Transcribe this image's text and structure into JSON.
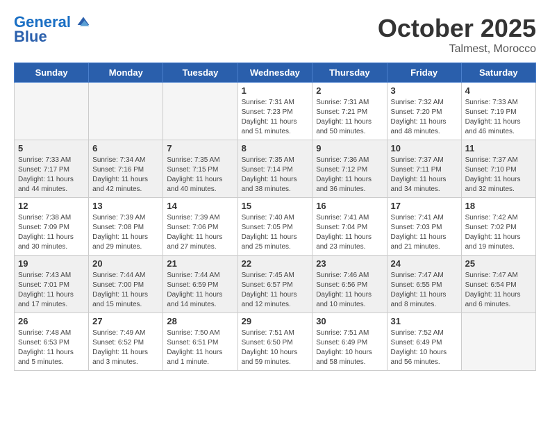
{
  "header": {
    "logo_line1": "General",
    "logo_line2": "Blue",
    "month": "October 2025",
    "location": "Talmest, Morocco"
  },
  "weekdays": [
    "Sunday",
    "Monday",
    "Tuesday",
    "Wednesday",
    "Thursday",
    "Friday",
    "Saturday"
  ],
  "weeks": [
    [
      {
        "day": "",
        "info": ""
      },
      {
        "day": "",
        "info": ""
      },
      {
        "day": "",
        "info": ""
      },
      {
        "day": "1",
        "info": "Sunrise: 7:31 AM\nSunset: 7:23 PM\nDaylight: 11 hours\nand 51 minutes."
      },
      {
        "day": "2",
        "info": "Sunrise: 7:31 AM\nSunset: 7:21 PM\nDaylight: 11 hours\nand 50 minutes."
      },
      {
        "day": "3",
        "info": "Sunrise: 7:32 AM\nSunset: 7:20 PM\nDaylight: 11 hours\nand 48 minutes."
      },
      {
        "day": "4",
        "info": "Sunrise: 7:33 AM\nSunset: 7:19 PM\nDaylight: 11 hours\nand 46 minutes."
      }
    ],
    [
      {
        "day": "5",
        "info": "Sunrise: 7:33 AM\nSunset: 7:17 PM\nDaylight: 11 hours\nand 44 minutes."
      },
      {
        "day": "6",
        "info": "Sunrise: 7:34 AM\nSunset: 7:16 PM\nDaylight: 11 hours\nand 42 minutes."
      },
      {
        "day": "7",
        "info": "Sunrise: 7:35 AM\nSunset: 7:15 PM\nDaylight: 11 hours\nand 40 minutes."
      },
      {
        "day": "8",
        "info": "Sunrise: 7:35 AM\nSunset: 7:14 PM\nDaylight: 11 hours\nand 38 minutes."
      },
      {
        "day": "9",
        "info": "Sunrise: 7:36 AM\nSunset: 7:12 PM\nDaylight: 11 hours\nand 36 minutes."
      },
      {
        "day": "10",
        "info": "Sunrise: 7:37 AM\nSunset: 7:11 PM\nDaylight: 11 hours\nand 34 minutes."
      },
      {
        "day": "11",
        "info": "Sunrise: 7:37 AM\nSunset: 7:10 PM\nDaylight: 11 hours\nand 32 minutes."
      }
    ],
    [
      {
        "day": "12",
        "info": "Sunrise: 7:38 AM\nSunset: 7:09 PM\nDaylight: 11 hours\nand 30 minutes."
      },
      {
        "day": "13",
        "info": "Sunrise: 7:39 AM\nSunset: 7:08 PM\nDaylight: 11 hours\nand 29 minutes."
      },
      {
        "day": "14",
        "info": "Sunrise: 7:39 AM\nSunset: 7:06 PM\nDaylight: 11 hours\nand 27 minutes."
      },
      {
        "day": "15",
        "info": "Sunrise: 7:40 AM\nSunset: 7:05 PM\nDaylight: 11 hours\nand 25 minutes."
      },
      {
        "day": "16",
        "info": "Sunrise: 7:41 AM\nSunset: 7:04 PM\nDaylight: 11 hours\nand 23 minutes."
      },
      {
        "day": "17",
        "info": "Sunrise: 7:41 AM\nSunset: 7:03 PM\nDaylight: 11 hours\nand 21 minutes."
      },
      {
        "day": "18",
        "info": "Sunrise: 7:42 AM\nSunset: 7:02 PM\nDaylight: 11 hours\nand 19 minutes."
      }
    ],
    [
      {
        "day": "19",
        "info": "Sunrise: 7:43 AM\nSunset: 7:01 PM\nDaylight: 11 hours\nand 17 minutes."
      },
      {
        "day": "20",
        "info": "Sunrise: 7:44 AM\nSunset: 7:00 PM\nDaylight: 11 hours\nand 15 minutes."
      },
      {
        "day": "21",
        "info": "Sunrise: 7:44 AM\nSunset: 6:59 PM\nDaylight: 11 hours\nand 14 minutes."
      },
      {
        "day": "22",
        "info": "Sunrise: 7:45 AM\nSunset: 6:57 PM\nDaylight: 11 hours\nand 12 minutes."
      },
      {
        "day": "23",
        "info": "Sunrise: 7:46 AM\nSunset: 6:56 PM\nDaylight: 11 hours\nand 10 minutes."
      },
      {
        "day": "24",
        "info": "Sunrise: 7:47 AM\nSunset: 6:55 PM\nDaylight: 11 hours\nand 8 minutes."
      },
      {
        "day": "25",
        "info": "Sunrise: 7:47 AM\nSunset: 6:54 PM\nDaylight: 11 hours\nand 6 minutes."
      }
    ],
    [
      {
        "day": "26",
        "info": "Sunrise: 7:48 AM\nSunset: 6:53 PM\nDaylight: 11 hours\nand 5 minutes."
      },
      {
        "day": "27",
        "info": "Sunrise: 7:49 AM\nSunset: 6:52 PM\nDaylight: 11 hours\nand 3 minutes."
      },
      {
        "day": "28",
        "info": "Sunrise: 7:50 AM\nSunset: 6:51 PM\nDaylight: 11 hours\nand 1 minute."
      },
      {
        "day": "29",
        "info": "Sunrise: 7:51 AM\nSunset: 6:50 PM\nDaylight: 10 hours\nand 59 minutes."
      },
      {
        "day": "30",
        "info": "Sunrise: 7:51 AM\nSunset: 6:49 PM\nDaylight: 10 hours\nand 58 minutes."
      },
      {
        "day": "31",
        "info": "Sunrise: 7:52 AM\nSunset: 6:49 PM\nDaylight: 10 hours\nand 56 minutes."
      },
      {
        "day": "",
        "info": ""
      }
    ]
  ]
}
